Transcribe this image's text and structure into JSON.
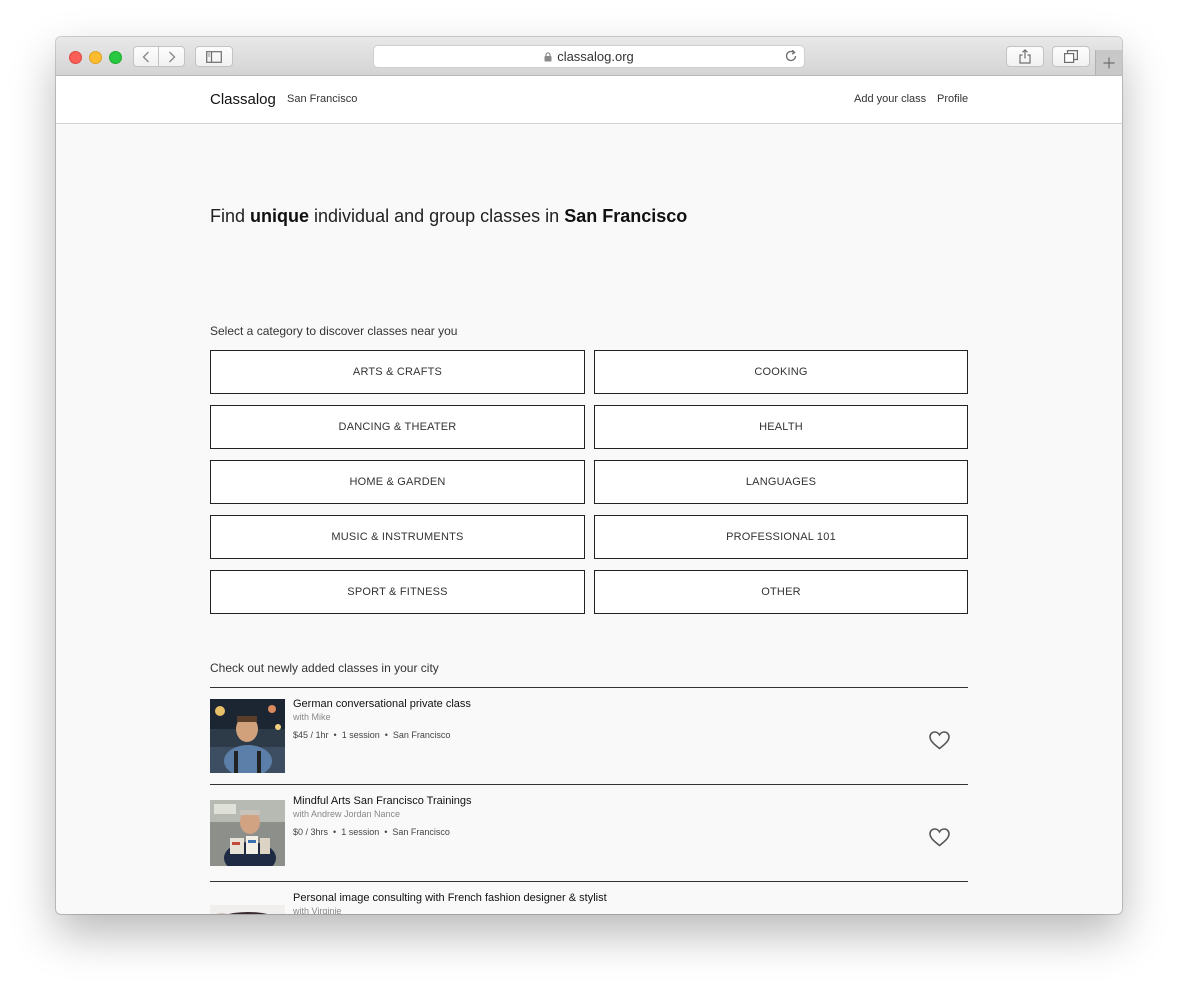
{
  "browser": {
    "url": "classalog.org"
  },
  "header": {
    "logo": "Classalog",
    "city": "San Francisco",
    "nav": [
      "Add your class",
      "Profile"
    ]
  },
  "hero": {
    "prefix": "Find ",
    "emphasis": "unique",
    "middle": " individual and group classes in ",
    "city": "San Francisco"
  },
  "categories": {
    "label": "Select a category to discover classes near you",
    "items": [
      "ARTS & CRAFTS",
      "COOKING",
      "DANCING & THEATER",
      "HEALTH",
      "HOME & GARDEN",
      "LANGUAGES",
      "MUSIC & INSTRUMENTS",
      "PROFESSIONAL 101",
      "SPORT & FITNESS",
      "OTHER"
    ]
  },
  "new_classes": {
    "label": "Check out newly added classes in your city",
    "items": [
      {
        "title": "German conversational private class",
        "with": "with Mike",
        "price": "$45 / 1hr",
        "sessions": "1 session",
        "location": "San Francisco"
      },
      {
        "title": "Mindful Arts San Francisco Trainings",
        "with": "with Andrew Jordan Nance",
        "price": "$0 / 3hrs",
        "sessions": "1 session",
        "location": "San Francisco"
      },
      {
        "title": "Personal image consulting with French fashion designer & stylist",
        "with": "with Virginie"
      }
    ]
  },
  "colors": {
    "traffic_red": "#fc5f57",
    "traffic_yellow": "#fdbc2e",
    "traffic_green": "#28c840",
    "page_bg": "#f9f9f9",
    "border": "#222222"
  }
}
